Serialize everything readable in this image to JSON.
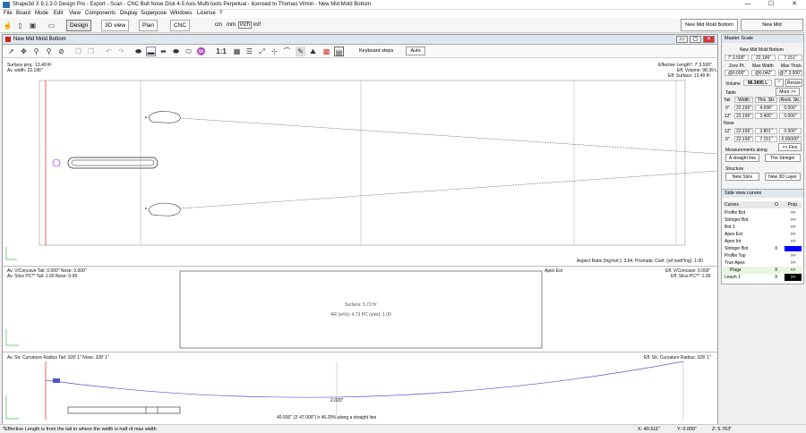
{
  "window": {
    "title": "Shape3d X 9.1.3.0 Design Pro - Export - Scan - CNC Bull Nose Disk 4-5 Axis Multi-tools Perpetual - licensed to Thomas Vilmin - New Mid Mold Bottom",
    "min": "—",
    "max": "☐",
    "close": "✕"
  },
  "menu": [
    "File",
    "Board",
    "Mode",
    "Edit",
    "View",
    "Components",
    "Display",
    "Superpose",
    "Windows",
    "License",
    "?"
  ],
  "toolbar": {
    "design": "Design",
    "view3d": "3D view",
    "plan": "Plan",
    "cnc": "CNC",
    "units": [
      "cm",
      "mm",
      "inch",
      "in/f"
    ],
    "unit_selected": "inch"
  },
  "board_tabs": [
    "New Mid Mold Bottom",
    "New Mid"
  ],
  "main": {
    "title": "New Mid Mold Bottom",
    "scale": "1:1",
    "keyboard_steps": "Keyboard steps",
    "auto": "Auto",
    "top_view": {
      "surface_proj": "Surface proj.: 13.49 ft²",
      "av_width": "Av. width: 22.196\"",
      "eff_length": "Effective Length*: 7' 3.500\"",
      "eff_volume": "Eff. Volume: 98.39 L",
      "eff_surface": "Eff. Surface: 13.49 ft²",
      "aspect": "Aspect Ratio (lng²/srf.): 3.94, Prismatic Coef. (srf./wdt*lng): 1.00"
    },
    "slice_view": {
      "concave_tail": "Av. V/Concave Tail: 0.000\" Nose: 0.000\"",
      "slice_pc": "Av. Slice PC** Tail: 1.00 Nose: 0.99",
      "apex": "Apex Ext",
      "eff_concave": "Eff. V/Concave: 0.000\"",
      "eff_slice": "Eff. Slice PC**: 1.00",
      "surface": "Surface: 5.72 ft²",
      "ar": "AR (w²/s): 4.73 PC (s/wt): 1.00"
    },
    "side_view": {
      "curv_tail": "Av. Str. Curvature Radius Tail: 328' 1\" Nose: 328' 1\"",
      "eff_curv": "Eff. Str. Curvature Radius: 328' 1\"",
      "rocker": "2.020\"",
      "bottom": "40.500\" (3' 47.000\") h 46.29% along a straight line"
    }
  },
  "master_scale": {
    "title": "Master Scale",
    "board_name": "New Mid Mold Bottom",
    "length": "7' 3.500\"",
    "width": "22.196\"",
    "thick": "7.151\"",
    "zero_pt": "Zero Pt.",
    "max_width": "Max Width",
    "max_thick": "Max Thick.",
    "zero_val": "@0.000\"",
    "maxw_val": "@0.042\"",
    "maxt_val": "@7' 3.000\"",
    "volume_label": "Volume",
    "volume": "98.3895 L",
    "star": "*",
    "resize": "Resize",
    "table": "Table",
    "more": "More >>",
    "cols": [
      "Width",
      "Thic. Str.",
      "Rock. Str."
    ],
    "tail_label": "Tail",
    "tail_rows": [
      [
        "0\"",
        "22.196\"",
        "4.698\"",
        "0.000\""
      ],
      [
        "12\"",
        "22.196\"",
        "3.405\"",
        "0.000\""
      ]
    ],
    "nose_label": "Nose",
    "nose_rows": [
      [
        "12\"",
        "22.196\"",
        "3.801\"",
        "0.000\""
      ],
      [
        "0\"",
        "22.196\"",
        "7.151\"",
        "0.00000\""
      ]
    ],
    "fins": "<< Fins",
    "measurements": "Measurements along",
    "straight": "A straight line",
    "stringer": "The Stringer",
    "structure": "Structure",
    "new_slice": "New Slice",
    "new_layer": "New 3D Layer"
  },
  "curves": {
    "title": "Side view curves",
    "hdr": [
      "Curves",
      "O.",
      "Prop."
    ],
    "items": [
      {
        "name": "Profile Bot",
        "o": "",
        "p": ">>"
      },
      {
        "name": "Stringer Bot",
        "o": "",
        "p": ">>"
      },
      {
        "name": "Bot 1",
        "o": "",
        "p": ">>"
      },
      {
        "name": "Apex Ext",
        "o": "",
        "p": ">>"
      },
      {
        "name": "Apex Int",
        "o": "",
        "p": ">>"
      },
      {
        "name": "Stringer Bot",
        "o": "X",
        "p": ""
      },
      {
        "name": "Profile Top",
        "o": "",
        "p": ">>"
      },
      {
        "name": "True Apex",
        "o": "",
        "p": ">>"
      },
      {
        "name": "Plugs",
        "o": "X",
        "p": "<<"
      },
      {
        "name": "Leash 1",
        "o": "X",
        "p": ">>"
      }
    ],
    "blue": "#0000ff"
  },
  "status": {
    "hint": "*Effective Length is from the tail to where the width is half of max width",
    "x": "X: 40.511\"",
    "y": "Y: 0.000\"",
    "z": "Z: 5.763\""
  }
}
